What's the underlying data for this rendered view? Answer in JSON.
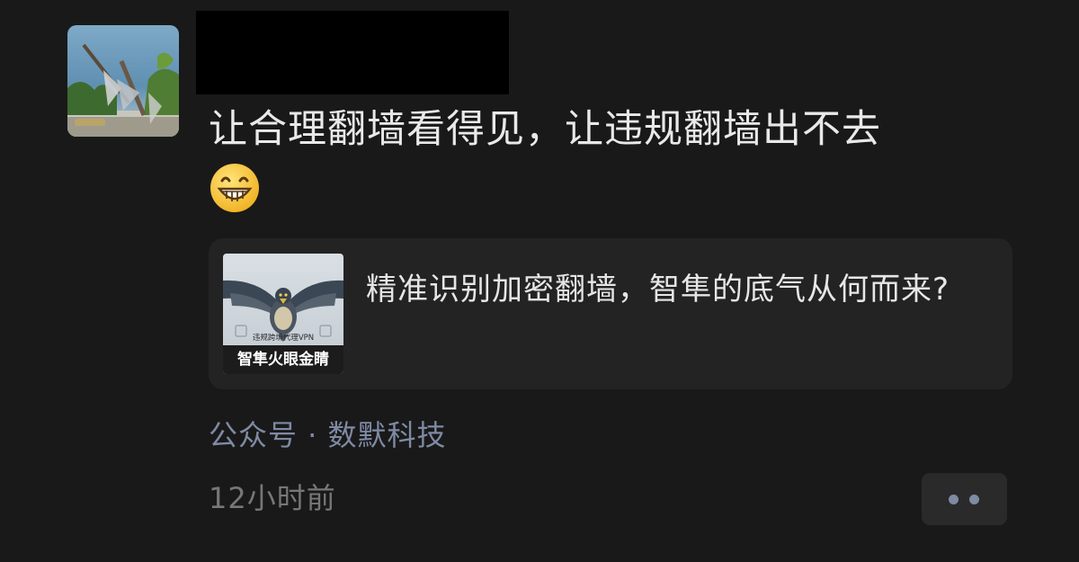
{
  "post": {
    "text": "让合理翻墙看得见，让违规翻墙出不去",
    "emoji": "grin-emoji",
    "time": "12小时前"
  },
  "link_card": {
    "title": "精准识别加密翻墙，智隼的底气从何而来?",
    "thumb_caption": "智隼火眼金睛",
    "thumb_subcaption": "违规跨境代理VPN"
  },
  "source": {
    "label": "公众号 · 数默科技"
  },
  "actions": {
    "more_icon": "more-dots-icon"
  },
  "colors": {
    "background": "#191919",
    "card_background": "#232323",
    "link_text": "#7f8aa3",
    "muted_text": "#777777",
    "primary_text": "#e9e9e9"
  }
}
